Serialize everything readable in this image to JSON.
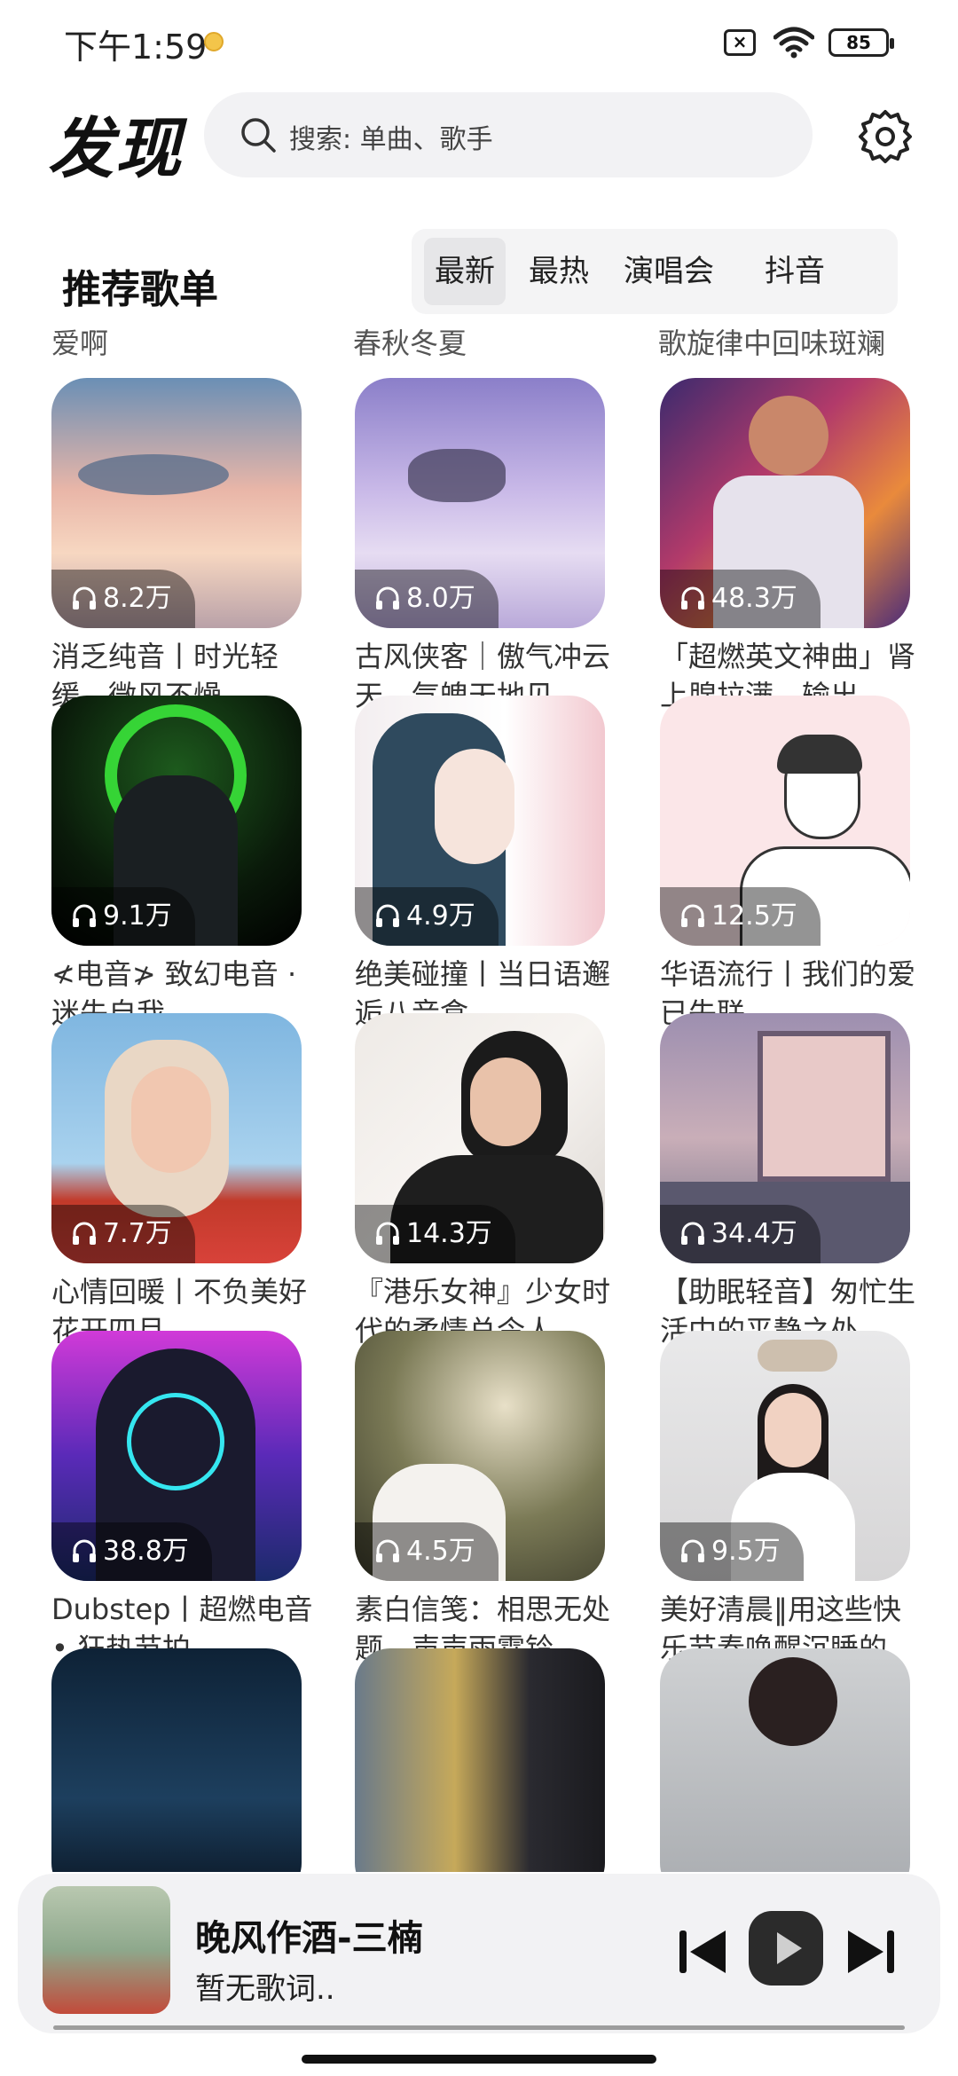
{
  "status_bar": {
    "time": "下午1:59",
    "battery": "85"
  },
  "header": {
    "title": "发现",
    "search_placeholder": "搜索: 单曲、歌手"
  },
  "section": {
    "title": "推荐歌单",
    "tabs": [
      "最新",
      "最热",
      "演唱会",
      "抖音"
    ],
    "active_tab": "最新"
  },
  "previous_row_captions": [
    "爱啊",
    "春秋冬夏",
    "歌旋律中回味斑斓"
  ],
  "playlists": [
    {
      "plays": "8.2万",
      "title": "消乏纯音丨时光轻缓，微风不燥"
    },
    {
      "plays": "8.0万",
      "title": "古风侠客｜傲气冲云天，气魄天地见"
    },
    {
      "plays": "48.3万",
      "title": "「超燃英文神曲」肾上腺拉满，输出"
    },
    {
      "plays": "9.1万",
      "title": "≮电音≯ 致幻电音 · 迷失自我"
    },
    {
      "plays": "4.9万",
      "title": "绝美碰撞丨当日语邂逅八音盒"
    },
    {
      "plays": "12.5万",
      "title": "华语流行丨我们的爱已失联"
    },
    {
      "plays": "7.7万",
      "title": "心情回暖丨不负美好花开四月"
    },
    {
      "plays": "14.3万",
      "title": "『港乐女神』少女时代的柔情总令人"
    },
    {
      "plays": "34.4万",
      "title": "【助眠轻音】匆忙生活中的平静之处."
    },
    {
      "plays": "38.8万",
      "title": "Dubstep丨超燃电音 • 狂热节拍"
    },
    {
      "plays": "4.5万",
      "title": "素白信笺：相思无处题，声声雨霖铃"
    },
    {
      "plays": "9.5万",
      "title": "美好清晨‖用这些快乐节奏唤醒沉睡的"
    },
    {
      "plays": "",
      "title": ""
    },
    {
      "plays": "",
      "title": ""
    },
    {
      "plays": "",
      "title": ""
    }
  ],
  "player": {
    "song": "晚风作酒-三楠",
    "lyric": "暂无歌词.."
  }
}
